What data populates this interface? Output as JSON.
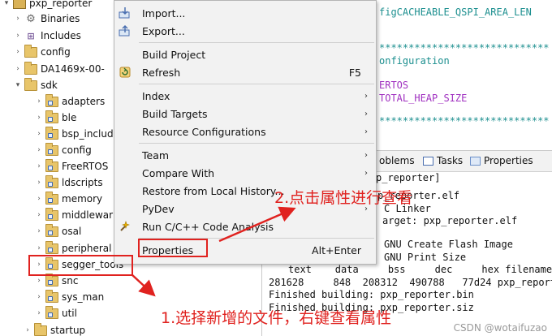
{
  "tree": {
    "items": [
      {
        "label": "pxp_reporter",
        "twisty": "▾",
        "icon": "project-folder-icon"
      },
      {
        "label": "Binaries",
        "twisty": "›",
        "icon": "binaries-icon"
      },
      {
        "label": "Includes",
        "twisty": "›",
        "icon": "includes-icon"
      },
      {
        "label": "config",
        "twisty": "›",
        "icon": "folder-icon"
      },
      {
        "label": "DA1469x-00-",
        "twisty": "›",
        "icon": "folder-icon"
      },
      {
        "label": "sdk",
        "twisty": "▾",
        "icon": "folder-icon"
      },
      {
        "label": "adapters",
        "twisty": "›",
        "icon": "folder-icon"
      },
      {
        "label": "ble",
        "twisty": "›",
        "icon": "folder-icon"
      },
      {
        "label": "bsp_includ",
        "twisty": "›",
        "icon": "folder-icon"
      },
      {
        "label": "config",
        "twisty": "›",
        "icon": "folder-icon"
      },
      {
        "label": "FreeRTOS",
        "twisty": "›",
        "icon": "folder-icon"
      },
      {
        "label": "ldscripts",
        "twisty": "›",
        "icon": "folder-icon"
      },
      {
        "label": "memory",
        "twisty": "›",
        "icon": "folder-icon"
      },
      {
        "label": "middlewar",
        "twisty": "›",
        "icon": "folder-icon"
      },
      {
        "label": "osal",
        "twisty": "›",
        "icon": "folder-icon"
      },
      {
        "label": "peripheral",
        "twisty": "›",
        "icon": "folder-icon"
      },
      {
        "label": "segger_tools",
        "twisty": "›",
        "icon": "folder-icon"
      },
      {
        "label": "snc",
        "twisty": "›",
        "icon": "folder-icon"
      },
      {
        "label": "sys_man",
        "twisty": "›",
        "icon": "folder-icon"
      },
      {
        "label": "util",
        "twisty": "›",
        "icon": "folder-icon"
      },
      {
        "label": "startup",
        "twisty": "›",
        "icon": "folder-icon"
      }
    ]
  },
  "editor": {
    "lines": [
      {
        "text": "figCACHEABLE_QSPI_AREA_LEN",
        "color": "teal"
      },
      {
        "text": "*****************************",
        "color": "teal"
      },
      {
        "text": "onfiguration",
        "color": "teal"
      },
      {
        "text": "ERTOS",
        "color": "purple"
      },
      {
        "text": "TOTAL_HEAP_SIZE",
        "color": "purple"
      },
      {
        "text": "*****************************",
        "color": "teal"
      }
    ]
  },
  "console": {
    "tabs": [
      {
        "label": "oblems",
        "icon": "problems-icon"
      },
      {
        "label": "Tasks",
        "icon": "tasks-icon"
      },
      {
        "label": "Properties",
        "icon": "properties-icon"
      }
    ],
    "lines": [
      "p_reporter]",
      "p_reporter.elf",
      "C Linker",
      "arget: pxp_reporter.elf",
      "GNU Create Flash Image",
      "GNU Print Size",
      "text    data     bss     dec     hex filename",
      "281628     848  208312  490788   77d24 pxp_report",
      "Finished building: pxp_reporter.bin",
      "Finished building: pxp_reporter.siz"
    ]
  },
  "menu": {
    "items": [
      {
        "label": "Import...",
        "icon": "import-icon",
        "shortcut": "",
        "submenu": false
      },
      {
        "label": "Export...",
        "icon": "export-icon",
        "shortcut": "",
        "submenu": false
      },
      {
        "label": "Build Project",
        "icon": "",
        "shortcut": "",
        "submenu": false
      },
      {
        "label": "Refresh",
        "icon": "refresh-icon",
        "shortcut": "F5",
        "submenu": false
      },
      {
        "label": "Index",
        "icon": "",
        "shortcut": "",
        "submenu": true
      },
      {
        "label": "Build Targets",
        "icon": "",
        "shortcut": "",
        "submenu": true
      },
      {
        "label": "Resource Configurations",
        "icon": "",
        "shortcut": "",
        "submenu": true
      },
      {
        "label": "Team",
        "icon": "",
        "shortcut": "",
        "submenu": true
      },
      {
        "label": "Compare With",
        "icon": "",
        "shortcut": "",
        "submenu": true
      },
      {
        "label": "Restore from Local History...",
        "icon": "",
        "shortcut": "",
        "submenu": false
      },
      {
        "label": "PyDev",
        "icon": "",
        "shortcut": "",
        "submenu": true
      },
      {
        "label": "Run C/C++ Code Analysis",
        "icon": "code-analysis-icon",
        "shortcut": "",
        "submenu": false
      },
      {
        "label": "Properties",
        "icon": "",
        "shortcut": "Alt+Enter",
        "submenu": false
      }
    ]
  },
  "annotations": {
    "step1": "1.选择新增的文件，右键查看属性",
    "step2": "2.点击属性进行查看",
    "color": "#e0221f"
  },
  "watermark": "CSDN @wotaifuzao"
}
